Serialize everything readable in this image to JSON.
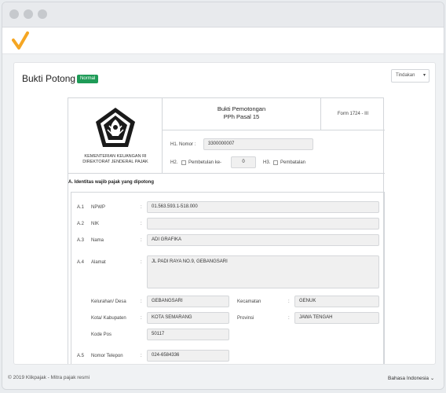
{
  "page": {
    "title": "Bukti Potong",
    "status_badge": "Normal",
    "action_button": "Tindakan"
  },
  "document": {
    "ministry_line1": "KEMENTERIAN KEUANGAN RI",
    "ministry_line2": "DIREKTORAT JENDERAL PAJAK",
    "heading_line1": "Bukti Pemotongan",
    "heading_line2": "PPh Pasal 15",
    "form_code": "Form 1724 - III",
    "h1_label": "H1. Nomor :",
    "h1_value": "3300000007",
    "h2_label": "H2.",
    "h2_text": "Pembetulan ke-",
    "h2_value": "0",
    "h3_label": "H3.",
    "h3_text": "Pembatalan",
    "section_a_title": "A. Identitas wajib pajak yang dipotong",
    "fields": {
      "a1_num": "A.1",
      "a1_label": "NPWP",
      "a1_value": "01.563.593.1-518.000",
      "a2_num": "A.2",
      "a2_label": "NIK",
      "a2_value": "",
      "a3_num": "A.3",
      "a3_label": "Nama",
      "a3_value": "ADI GRAFIKA",
      "a4_num": "A.4",
      "a4_label": "Alamat",
      "a4_value": "JL PADI RAYA NO.9, GEBANGSARI",
      "kelurahan_label": "Kelurahan/ Desa",
      "kelurahan_value": "GEBANGSARI",
      "kecamatan_label": "Kecamatan",
      "kecamatan_value": "GENUK",
      "kota_label": "Kota/ Kabupaten",
      "kota_value": "KOTA SEMARANG",
      "provinsi_label": "Provinsi",
      "provinsi_value": "JAWA TENGAH",
      "kodepos_label": "Kode Pos",
      "kodepos_value": "50117",
      "a5_num": "A.5",
      "a5_label": "Nomor Telepon",
      "a5_value": "024-6584336",
      "colon": ":"
    }
  },
  "footer": {
    "copyright": "© 2019 Klikpajak - Mitra pajak resmi",
    "language": "Bahasa Indonesia"
  },
  "colors": {
    "brand": "#f5a623",
    "badge": "#1e9b57"
  }
}
